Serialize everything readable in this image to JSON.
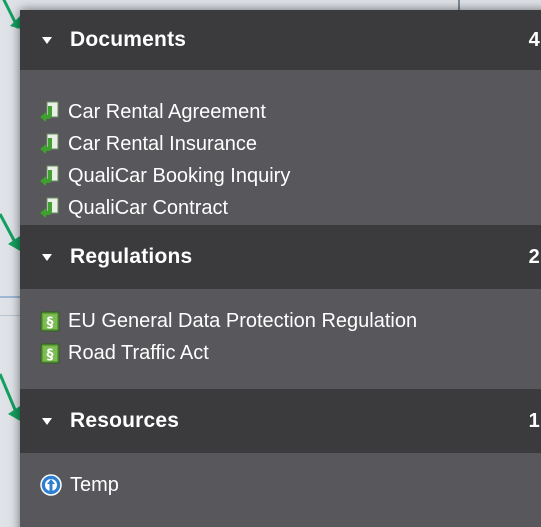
{
  "sections": [
    {
      "title": "Documents",
      "count": "4",
      "items": [
        {
          "label": "Car Rental Agreement",
          "icon": "document-arrow-icon"
        },
        {
          "label": "Car Rental Insurance",
          "icon": "document-arrow-icon"
        },
        {
          "label": "QualiCar Booking Inquiry",
          "icon": "document-arrow-icon"
        },
        {
          "label": "QualiCar Contract",
          "icon": "document-arrow-icon"
        }
      ]
    },
    {
      "title": "Regulations",
      "count": "2",
      "items": [
        {
          "label": "EU General Data Protection Regulation",
          "icon": "section-sign-icon"
        },
        {
          "label": "Road Traffic Act",
          "icon": "section-sign-icon"
        }
      ]
    },
    {
      "title": "Resources",
      "count": "1",
      "items": [
        {
          "label": "Temp",
          "icon": "resource-globe-icon"
        }
      ]
    }
  ],
  "colors": {
    "header_bg": "#3b3b3d",
    "body_bg": "#57575c",
    "accent_green": "#3f9f2f",
    "connector_green": "#14a060"
  }
}
